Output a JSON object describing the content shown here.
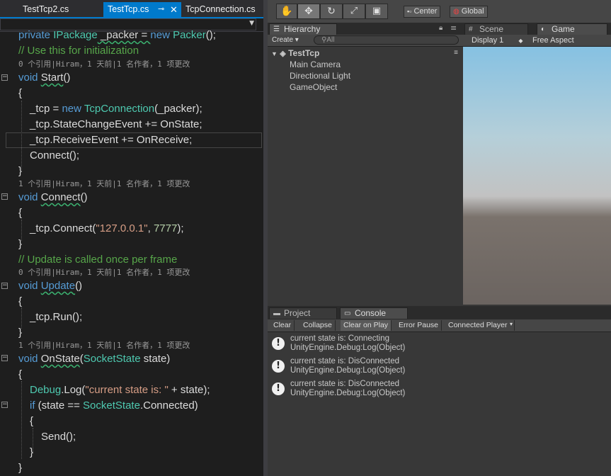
{
  "editor": {
    "tabs": [
      {
        "label": "TestTcp2.cs",
        "active": false
      },
      {
        "label": "TestTcp.cs",
        "active": true
      },
      {
        "label": "TcpConnection.cs",
        "active": false
      }
    ],
    "codelens": "0 个引用|Hiram，1 天前|1 名作者，1 项更改",
    "codelens_1": "1 个引用|Hiram，1 天前|1 名作者，1 项更改",
    "lines": {
      "l1": [
        "private ",
        "IPackage",
        " _packer = ",
        "new ",
        "Packer",
        "();"
      ],
      "l2": "// Use this for initialization",
      "l3": [
        "void ",
        "Start",
        "()"
      ],
      "l4": "{",
      "l5": [
        "_tcp = ",
        "new ",
        "TcpConnection",
        "(_packer);"
      ],
      "l6": "_tcp.StateChangeEvent += OnState;",
      "l7": "_tcp.ReceiveEvent += OnReceive;",
      "l8": "Connect();",
      "l9": "}",
      "l10": [
        "void ",
        "Connect",
        "()"
      ],
      "l11": "{",
      "l12": [
        "_tcp.Connect(",
        "\"127.0.0.1\"",
        ", ",
        "7777",
        ");"
      ],
      "l13": "}",
      "l14": "// Update is called once per frame",
      "l15": [
        "void ",
        "Update",
        "()"
      ],
      "l16": "{",
      "l17": "_tcp.Run();",
      "l18": "}",
      "l19": [
        "void ",
        "OnState",
        "(",
        "SocketState",
        " state)"
      ],
      "l20": "{",
      "l21": [
        "Debug",
        ".Log(",
        "\"current state is: \"",
        " + state);"
      ],
      "l22": [
        "if ",
        "(state == ",
        "SocketState",
        ".Connected)"
      ],
      "l23": "{",
      "l24": "Send();",
      "l25": "}",
      "l26": "}"
    }
  },
  "unity": {
    "toolbar": {
      "tools": [
        "hand-tool-icon",
        "move-tool-icon",
        "rotate-tool-icon",
        "scale-tool-icon",
        "rect-tool-icon"
      ],
      "pivot": "Center",
      "space": "Global"
    },
    "hierarchy": {
      "tab": "Hierarchy",
      "create": "Create",
      "search_placeholder": "All",
      "scene": "TestTcp",
      "items": [
        "Main Camera",
        "Directional Light",
        "GameObject"
      ]
    },
    "tabs": {
      "scene": "Scene",
      "game": "Game"
    },
    "game": {
      "display": "Display 1",
      "aspect": "Free Aspect"
    },
    "bottom_tabs": {
      "project": "Project",
      "console": "Console"
    },
    "console": {
      "buttons": [
        "Clear",
        "Collapse",
        "Clear on Play",
        "Error Pause",
        "Connected Player"
      ],
      "logs": [
        {
          "msg": "current state is: Connecting",
          "src": "UnityEngine.Debug:Log(Object)"
        },
        {
          "msg": "current state is: DisConnected",
          "src": "UnityEngine.Debug:Log(Object)"
        },
        {
          "msg": "current state is: DisConnected",
          "src": "UnityEngine.Debug:Log(Object)"
        }
      ]
    },
    "colors": {
      "accent": "#007acc",
      "keyword": "#569cd6",
      "type": "#4ec9b0",
      "comment": "#57a64a",
      "string": "#d69d85"
    }
  }
}
